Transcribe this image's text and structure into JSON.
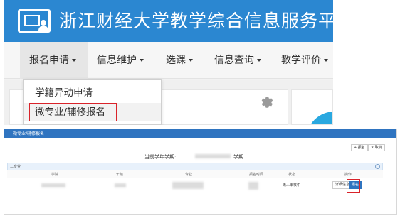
{
  "header": {
    "site_title": "浙江财经大学教学综合信息服务平台",
    "logo_icon": "classroom-screen-icon",
    "bg_color": "#2b87d1"
  },
  "nav": {
    "items": [
      {
        "label": "报名申请"
      },
      {
        "label": "信息维护"
      },
      {
        "label": "选课"
      },
      {
        "label": "信息查询"
      },
      {
        "label": "教学评价"
      }
    ]
  },
  "dropdown": {
    "items": [
      {
        "label": "学籍异动申请"
      },
      {
        "label": "微专业/辅修报名"
      }
    ],
    "highlight_color": "#d9232a"
  },
  "settings": {
    "icon": "gear-icon"
  },
  "page": {
    "title": "微专业/辅修报名",
    "buttons": [
      {
        "label": "+ 报名",
        "icon": "plus-icon"
      },
      {
        "label": "✕ 取消",
        "icon": "close-icon"
      }
    ],
    "term_prefix": "当前学年学期:",
    "term_suffix": "学期",
    "section_title": "二专业",
    "table": {
      "headers": [
        "学院",
        "年级",
        "专业",
        "报名时间",
        "状态",
        "操作"
      ],
      "row": {
        "status": "无人审核中",
        "actions": [
          {
            "label": "详细信息"
          },
          {
            "label": "报名"
          }
        ]
      }
    }
  }
}
